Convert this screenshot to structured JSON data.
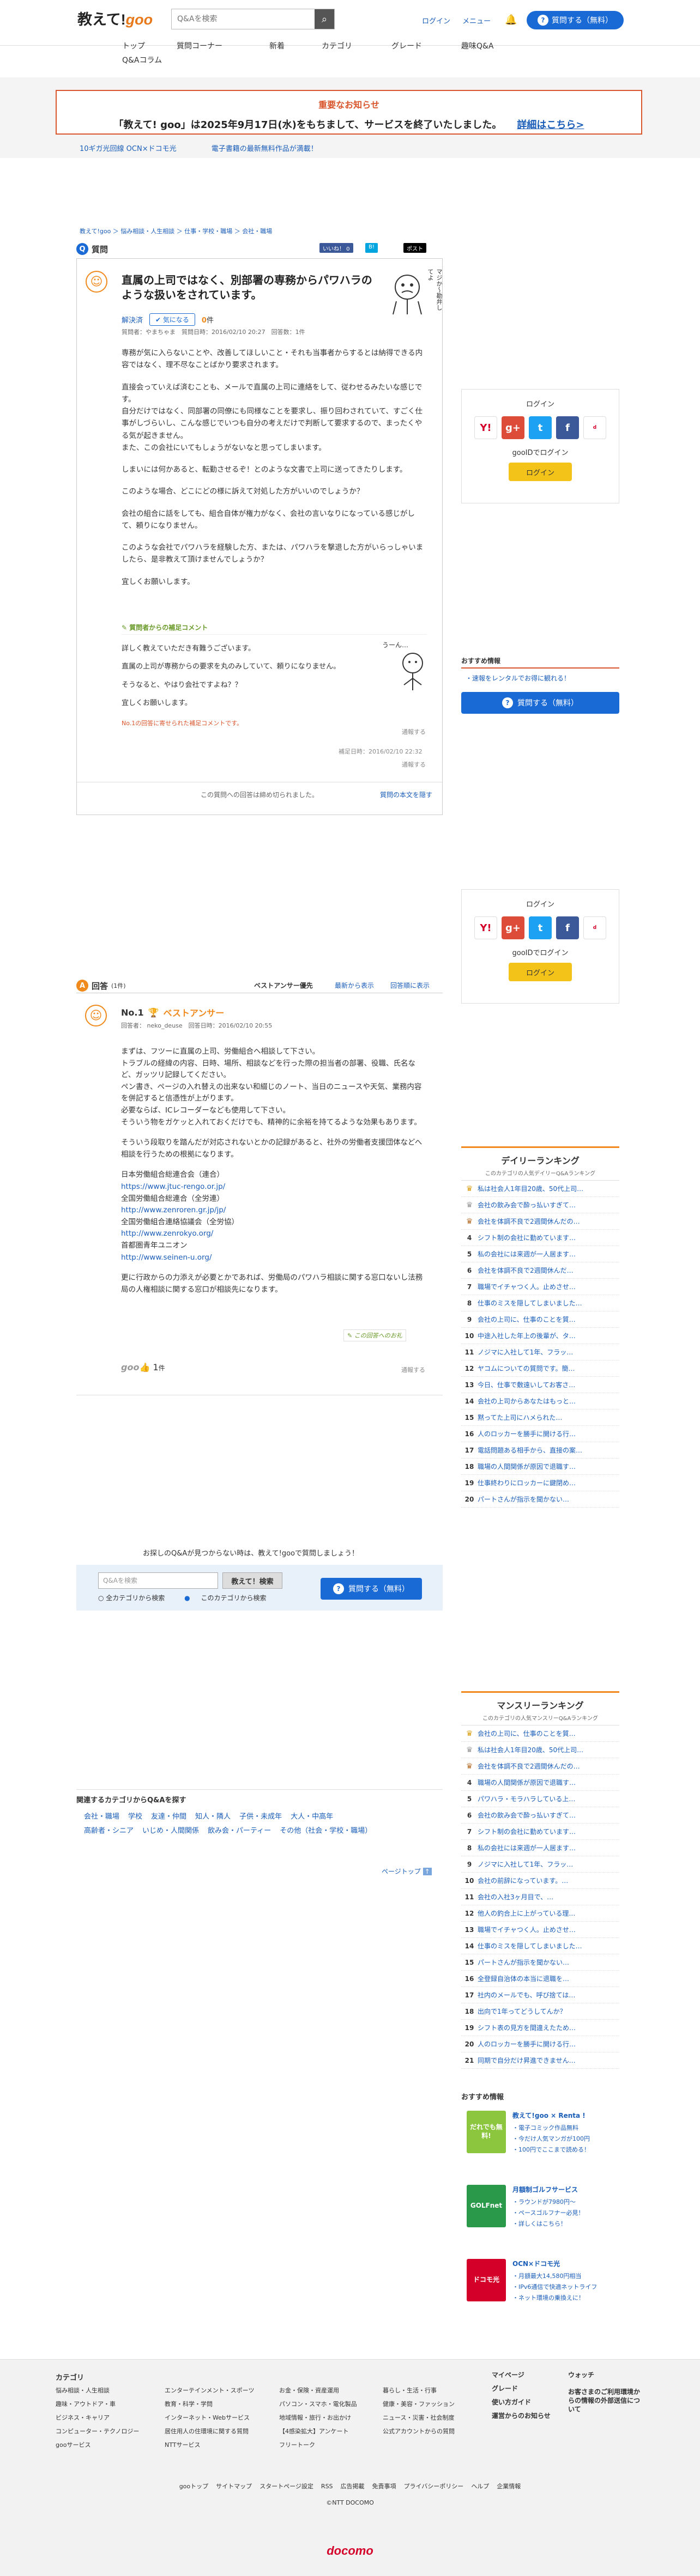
{
  "header": {
    "logo_text": "教えて!",
    "logo_goo": "goo",
    "search_placeholder": "Q&Aを検索",
    "login": "ログイン",
    "menu": "メニュー",
    "ask_button": "質問する（無料）"
  },
  "nav": [
    "トップ",
    "質問コーナー",
    "新着",
    "カテゴリ",
    "グレード",
    "趣味Q&A"
  ],
  "nav2": "Q&Aコラム",
  "notice": {
    "title": "重要なお知らせ",
    "body": "「教えて! goo」は2025年9月17日(水)をもちまして、サービスを終了いたしました。",
    "link": "詳細はこちら>"
  },
  "subbanners": [
    "10ギガ光回線 OCN×ドコモ光",
    "電子書籍の最新無料作品が満載！"
  ],
  "breadcrumb": "教えて!goo ＞ 悩み相談・人生相談 ＞ 仕事・学校・職場 ＞ 会社・職場",
  "question": {
    "section_label": "質問",
    "share": [
      "いいね！ 0",
      "B!",
      "ポスト"
    ],
    "title": "直属の上司ではなく、別部署の専務からパワハラのような扱いをされています。",
    "illust_caption": "マジか〜勘弁してよ",
    "status": "解決済",
    "me_too": "気になる",
    "goo_count": "0",
    "goo_unit": "件",
    "meta": "質問者：やまちゃま　質問日時：2016/02/10 20:27　回答数：1件",
    "body": [
      "専務が気に入らないことや、改善してほしいこと・それも当事者からするとは納得できる内容ではなく、理不尽なことばかり要求されます。",
      "直接会っていえば済むことも、メールで直属の上司に連絡をして、従わせるみたいな感じです。\n自分だけではなく、同部署の同僚にも同様なことを要求し、振り回わされていて、すごく仕事がしづらいし、こんな感じでいつも自分の考えだけで判断して要求するので、まったくやる気が起きません。\nまた、この会社にいてもしょうがないなと思ってしまいます。",
      "しまいには何かあると、転勤させるぞ！とのような文書で上司に送ってきたりします。",
      "このような場合、どこにどの様に訴えて対処した方がいいのでしょうか？",
      "会社の組合に話をしても、組合自体が権力がなく、会社の言いなりになっている感じがして、頼りになりません。",
      "このような会社でパワハラを経験した方、または、パワハラを撃退した方がいらっしゃいましたら、是非教えて頂けませんでしょうか？",
      "宜しくお願いします。"
    ],
    "supp_tag": "質問者からの補足コメント",
    "supp_body": [
      "詳しく教えていただき有難うございます。",
      "直属の上司が専務からの要求を丸のみしていて、頼りになりません。",
      "そうなると、やはり会社ですよね？？",
      "宜しくお願いします。"
    ],
    "supp_illust": "うーん…",
    "supp_reply": "No.1の回答に寄せられた補足コメントです。",
    "supp_date": "補足日時：2016/02/10 22:32",
    "report": "通報する",
    "closed": "この質問への回答は締め切られました。",
    "ask_similar": "質問の本文を隠す"
  },
  "login_box": {
    "title": "ログイン",
    "goo_login": "gooIDでログイン",
    "button": "ログイン"
  },
  "recommend": {
    "head": "おすすめ情報",
    "link": "・速報をレンタルでお得に観れる！",
    "ask": "質問する（無料）"
  },
  "answers": {
    "section_label": "回答",
    "count": "(1件)",
    "tabs": [
      "ベストアンサー優先",
      "最新から表示",
      "回答順に表示"
    ],
    "no": "No.1",
    "best": "ベストアンサー",
    "meta": "回答者： neko_deuse　回答日時：2016/02/10 20:55",
    "body": [
      "まずは、フツーに直属の上司、労働組合へ相談して下さい。\nトラブルの経緯の内容、日時、場所、相談などを行った際の担当者の部署、役職、氏名など、ガッツリ記録してください。\nペン書き、ページの入れ替えの出来ない和綴じのノート、当日のニュースや天気、業務内容を併記すると信憑性が上がります。\n必要ならば、ICレコーダーなども使用して下さい。\nそういう物をガケッと入れておくだけでも、精神的に余裕を持てるような効果もあります。",
      "そういう段取りを踏んだが対応されないとかの記録があると、社外の労働者支援団体などへ相談を行うための根拠になります。",
      "日本労働組合総連合会（連合）",
      "https://www.jtuc-rengo.or.jp/",
      "全国労働組合総連合（全労連）",
      "http://www.zenroren.gr.jp/jp/",
      "全国労働組合連絡協議会（全労協）",
      "http://www.zenrokyo.org/",
      "首都圏青年ユニオン",
      "http://www.seinen-u.org/",
      "更に行政からの力添えが必要とかであれば、労働局のパワハラ相談に関する窓口ないし法務局の人権相談に関する窓口が相談先になります。"
    ],
    "thanks": "この回答へのお礼",
    "goo_label": "goo",
    "goo_count": "1",
    "goo_unit": "件",
    "report": "通報する"
  },
  "bottom_search": {
    "not_found": "お探しのQ&Aが見つからない時は、教えて!gooで質問しましょう！",
    "placeholder": "Q&Aを検索",
    "button": "教えて！検索",
    "radio_all": "全カテゴリから検索",
    "radio_this": "このカテゴリから検索",
    "ask": "質問する（無料）"
  },
  "daily_ranking": {
    "title": "デイリーランキング",
    "sub": "このカテゴリの人気デイリーQ&Aランキング",
    "items": [
      "私は社会人1年目20歳、50代上司…",
      "会社の飲み会で酔っ払いすぎて…",
      "会社を体調不良で2週間休んだの…",
      "シフト制の会社に勤めています…",
      "私の会社には来週が一人居ます…",
      "会社を体調不良で2週間休んだ…",
      "職場でイチャつく人。止めさせ…",
      "仕事のミスを隠してしまいました…",
      "会社の上司に、仕事のことを質…",
      "中途入社した年上の後輩が、タ…",
      "ノジマに入社して1年、フラッ…",
      "ヤコムについての質問です。簡…",
      "今日、仕事で敷遠いしてお客さ…",
      "会社の上司からあなたはもっと…",
      "黙ってた上司にハメられた…",
      "人のロッカーを勝手に開ける行…",
      "電話問題ある相手から、直接の案…",
      "職場の人間関係が原因で退職す…",
      "仕事終わりにロッカーに鍵閉め…",
      "パートさんが指示を聞かない…"
    ]
  },
  "monthly_ranking": {
    "title": "マンスリーランキング",
    "sub": "このカテゴリの人気マンスリーQ&Aランキング",
    "items": [
      "会社の上司に、仕事のことを質…",
      "私は社会人1年目20歳、50代上司…",
      "会社を体調不良で2週間休んだの…",
      "職場の人間関係が原因で退職す…",
      "パワハラ・モラハラしている上…",
      "会社の飲み会で酔っ払いすぎて…",
      "シフト制の会社に勤めています…",
      "私の会社には来週が一人居ます…",
      "ノジマに入社して1年、フラッ…",
      "会社の前辞になっています。…",
      "会社の入社3ヶ月目で、…",
      "他人の釣合上に上がっている理…",
      "職場でイチャつく人。止めさせ…",
      "仕事のミスを隠してしまいました…",
      "パートさんが指示を聞かない…",
      "全登録自治体の本当に退職を…",
      "社内のメールでも、呼び捨ては…",
      "出向で1年ってどうしてんか？",
      "シフト表の見方を間違えたため…",
      "人のロッカーを勝手に開ける行…",
      "同期で自分だけ昇進できません…"
    ]
  },
  "related": {
    "title": "関連するカテゴリからQ&Aを探す",
    "links": [
      "会社・職場",
      "学校",
      "友達・仲間",
      "知人・隣人",
      "子供・未成年",
      "大人・中高年",
      "高齢者・シニア",
      "いじめ・人間関係",
      "飲み会・パーティー",
      "その他（社会・学校・職場）"
    ],
    "page_top": "ページトップ"
  },
  "osusume": {
    "head": "おすすめ情報",
    "promos": [
      {
        "img": "だれでも無料!",
        "title": "教えて!goo × Renta !",
        "items": [
          "・電子コミック作品無料",
          "・今だけ人気マンガが100円",
          "・100円でここまで読める！"
        ]
      },
      {
        "img": "GOLFnet",
        "title": "月額制ゴルフサービス",
        "items": [
          "・ラウンドが7980円〜",
          "・ペースゴルフナー必見！",
          "・詳しくはこちら！"
        ]
      },
      {
        "img": "ドコモ光",
        "title": "OCN×ドコモ光",
        "items": [
          "・月額最大14,580円相当",
          "・IPv6通信で快適ネットライフ",
          "・ネット環境の乗換えに！"
        ]
      }
    ]
  },
  "footer": {
    "col1_title": "カテゴリ",
    "col1": [
      "悩み相談・人生相談",
      "趣味・アウトドア・車",
      "ビジネス・キャリア",
      "コンピューター・テクノロジー",
      "gooサービス"
    ],
    "col2": [
      "エンターテインメント・スポーツ",
      "教育・科学・学問",
      "インターネット・Webサービス",
      "居住用人の住環境に関する質問",
      "NTTサービス"
    ],
    "col3": [
      "お金・保険・資産運用",
      "パソコン・スマホ・電化製品",
      "地域情報・旅行・お出かけ",
      "【4感染拡大】アンケート",
      "フリートーク"
    ],
    "col4": [
      "暮らし・生活・行事",
      "健康・美容・ファッション",
      "ニュース・災害・社会制度",
      "公式アカウントからの質問"
    ],
    "col5": [
      "マイページ",
      "グレード",
      "使い方ガイド",
      "運営からのお知らせ"
    ],
    "col6": [
      "ウォッチ",
      "お客さまのご利用環境からの情報の外部送信について"
    ],
    "bottom_links": [
      "gooトップ",
      "サイトマップ",
      "スタートページ設定",
      "RSS",
      "広告掲載",
      "免責事項",
      "プライバシーポリシー",
      "ヘルプ",
      "企業情報"
    ],
    "copyright": "©NTT DOCOMO",
    "docomo": "docomo"
  },
  "colors": {
    "accent": "#1a6ad6",
    "brand_orange": "#f08a1c",
    "notice_red": "#d9552c"
  }
}
